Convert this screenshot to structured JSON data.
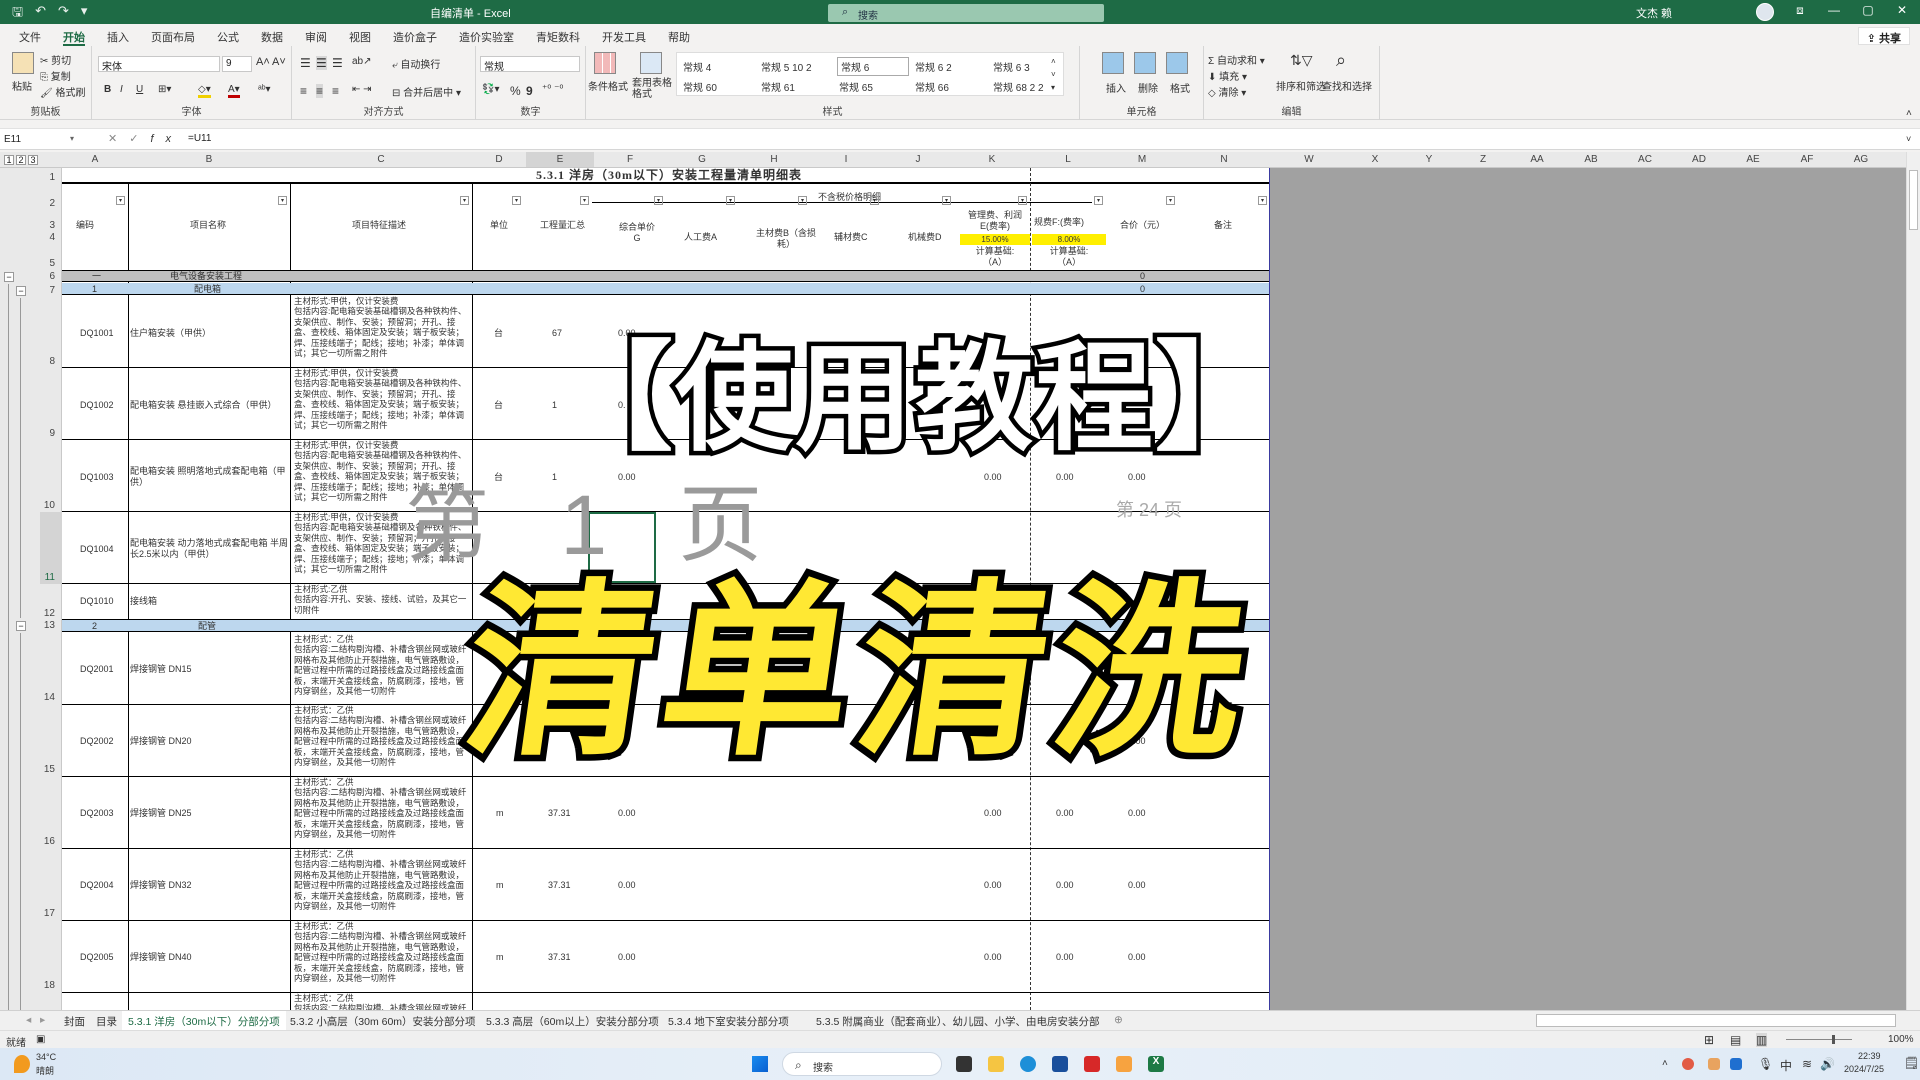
{
  "window": {
    "title": "自编清单 - Excel",
    "search_placeholder": "搜索",
    "user_name": "文杰 赖",
    "controls": {
      "restore_ribbon": "⧈",
      "minimize": "—",
      "maximize": "▢",
      "close": "✕"
    }
  },
  "menu": {
    "tabs": [
      "文件",
      "开始",
      "插入",
      "页面布局",
      "公式",
      "数据",
      "审阅",
      "视图",
      "造价盒子",
      "造价实验室",
      "青矩数科",
      "开发工具",
      "帮助"
    ],
    "active": "开始",
    "share_label": "共享"
  },
  "ribbon": {
    "clipboard": {
      "label": "剪贴板",
      "paste": "粘贴",
      "cut": "剪切",
      "copy": "复制",
      "format_painter": "格式刷"
    },
    "font": {
      "label": "字体",
      "font_name": "宋体",
      "font_size": "9",
      "bold": "B",
      "italic": "I",
      "underline": "U"
    },
    "alignment": {
      "label": "对齐方式",
      "wrap_text": "自动换行",
      "merge_center": "合并后居中"
    },
    "number": {
      "label": "数字",
      "format": "常规",
      "percent": "%",
      "comma": "9"
    },
    "styles": {
      "label": "样式",
      "conditional_format": "条件格式",
      "table_format": "套用表格格式",
      "items": [
        "常规 4",
        "常规 5 10 2",
        "常规 6",
        "常规 6 2",
        "常规 6 3",
        "常规 60",
        "常规 61",
        "常规 65",
        "常规 66",
        "常规 68 2 2"
      ],
      "selected": "常规 6"
    },
    "cells": {
      "label": "单元格",
      "insert": "插入",
      "delete": "删除",
      "format": "格式"
    },
    "editing": {
      "label": "编辑",
      "autosum": "自动求和",
      "fill": "填充",
      "clear": "清除",
      "sort_filter": "排序和筛选",
      "find_select": "查找和选择"
    }
  },
  "formula_bar": {
    "name_box": "E11",
    "formula": "=U11"
  },
  "columns": [
    "A",
    "B",
    "C",
    "D",
    "E",
    "F",
    "G",
    "H",
    "I",
    "J",
    "K",
    "L",
    "M",
    "N",
    "W",
    "X",
    "Y",
    "Z",
    "AA",
    "AB",
    "AC",
    "AD",
    "AE",
    "AF",
    "AG"
  ],
  "rows": [
    "1",
    "2",
    "3",
    "4",
    "5",
    "6",
    "7",
    "8",
    "9",
    "10",
    "11",
    "12",
    "13",
    "14",
    "15",
    "16",
    "17",
    "18"
  ],
  "sheet": {
    "title": "5.3.1 洋房（30m以下）安装工程量清单明细表",
    "headers": {
      "code": "编码",
      "name": "项目名称",
      "desc": "项目特征描述",
      "unit": "单位",
      "qty": "工程量汇总",
      "unit_price": "综合单价G",
      "not_included": "不含税价格明细",
      "labor": "人工费A",
      "main_material": "主材费B（含损耗）",
      "aux_material": "辅材费C",
      "machine": "机械费D",
      "mgmt": "管理费、利润E(费率)",
      "mgmt_rate": "15.00%",
      "fee": "规费F:(费率)",
      "fee_rate": "8.00%",
      "calc_base": "计算基础:",
      "calc_base_val": "（A）",
      "total": "合价（元）",
      "remark": "备注"
    },
    "section_rows": [
      {
        "code": "一",
        "name": "电气设备安装工程",
        "total": "0"
      },
      {
        "code": "1",
        "name": "配电箱",
        "total": "0"
      }
    ],
    "items": [
      {
        "code": "DQ1001",
        "name": "住户箱安装（甲供）",
        "desc": "主材形式:甲供，仅计安装费\n包括内容:配电箱安装基础槽钢及各种铁构件、支架供应、制作、安装；预留洞；开孔、接盒、查校线、箱体固定及安装；端子板安装；焊、压接线端子；配线；接地；补漆；单体调试；其它一切所需之附件",
        "unit": "台",
        "qty": "67",
        "price": "0.00"
      },
      {
        "code": "DQ1002",
        "name": "配电箱安装 悬挂嵌入式综合（甲供）",
        "desc": "主材形式:甲供，仅计安装费\n包括内容:配电箱安装基础槽钢及各种铁构件、支架供应、制作、安装；预留洞；开孔、接盒、查校线、箱体固定及安装；端子板安装；焊、压接线端子；配线；接地；补漆；单体调试；其它一切所需之附件",
        "unit": "台",
        "qty": "1",
        "price": "0."
      },
      {
        "code": "DQ1003",
        "name": "配电箱安装 照明落地式成套配电箱（甲供）",
        "desc": "主材形式:甲供，仅计安装费\n包括内容:配电箱安装基础槽钢及各种铁构件、支架供应、制作、安装；预留洞；开孔、接盒、查校线、箱体固定及安装；端子板安装；焊、压接线端子；配线；接地；补漆；单体调试；其它一切所需之附件",
        "unit": "台",
        "qty": "1",
        "price": "0.00",
        "k": "0.00",
        "l": "0.00",
        "m": "0.00"
      },
      {
        "code": "DQ1004",
        "name": "配电箱安装 动力落地式成套配电箱 半周长2.5米以内（甲供）",
        "desc": "主材形式:甲供，仅计安装费\n包括内容:配电箱安装基础槽钢及各种铁构件、支架供应、制作、安装；预留洞；开孔、接盒、查校线、箱体固定及安装；端子板安装；焊、压接线端子；配线；接地；补漆；单体调试；其它一切所需之附件",
        "unit": "",
        "qty": "",
        "price": ""
      },
      {
        "code": "DQ1010",
        "name": "接线箱",
        "desc": "主材形式:乙供\n包括内容:开孔、安装、接线、试验，及其它一切附件",
        "unit": "",
        "qty": "",
        "price": ""
      }
    ],
    "section2": {
      "code": "2",
      "name": "配管"
    },
    "pipe_items": [
      {
        "code": "DQ2001",
        "name": "焊接钢管 DN15",
        "unit": "",
        "qty": "",
        "price": "",
        "k": "",
        "l": "",
        "m": "0.00"
      },
      {
        "code": "DQ2002",
        "name": "焊接钢管 DN20",
        "unit": "",
        "qty": "",
        "price": "0.",
        "k": "",
        "l": "",
        "m": "0.00"
      },
      {
        "code": "DQ2003",
        "name": "焊接钢管 DN25",
        "unit": "m",
        "qty": "37.31",
        "price": "0.00",
        "k": "0.00",
        "l": "0.00",
        "m": "0.00"
      },
      {
        "code": "DQ2004",
        "name": "焊接钢管 DN32",
        "unit": "m",
        "qty": "37.31",
        "price": "0.00",
        "k": "0.00",
        "l": "0.00",
        "m": "0.00"
      },
      {
        "code": "DQ2005",
        "name": "焊接钢管 DN40",
        "unit": "m",
        "qty": "37.31",
        "price": "0.00",
        "k": "0.00",
        "l": "0.00",
        "m": "0.00"
      }
    ],
    "pipe_desc": "主材形式：乙供\n包括内容:二结构剔沟槽、补槽含钢丝网或玻纤网格布及其他防止开裂措施，电气管路敷设，配管过程中所需的过路接线盒及过路接线盒面板，末端开关盒接线盒，防腐刷漆，接地，管内穿钢丝，及其他一切附件",
    "page_watermark_1": "第 1 页",
    "page_watermark_24": "第 24 页"
  },
  "overlay": {
    "line1": "【使用教程】",
    "line2": "清单清洗"
  },
  "sheet_tabs": {
    "items": [
      "封面",
      "目录",
      "5.3.1 洋房（30m以下）分部分项",
      "5.3.2 小高层（30m 60m）安装分部分项",
      "5.3.3 高层（60m以上）安装分部分项",
      "5.3.4 地下室安装分部分项",
      "5.3.5 附属商业（配套商业）、幼儿园、小学、由电房安装分部"
    ],
    "active": "5.3.1 洋房（30m以下）分部分项"
  },
  "status": {
    "ready": "就绪",
    "zoom": "100%"
  },
  "taskbar": {
    "weather_temp": "34°C",
    "weather_desc": "晴朗",
    "search": "搜索",
    "time": "22:39",
    "date": "2024/7/25",
    "ime": "中"
  }
}
